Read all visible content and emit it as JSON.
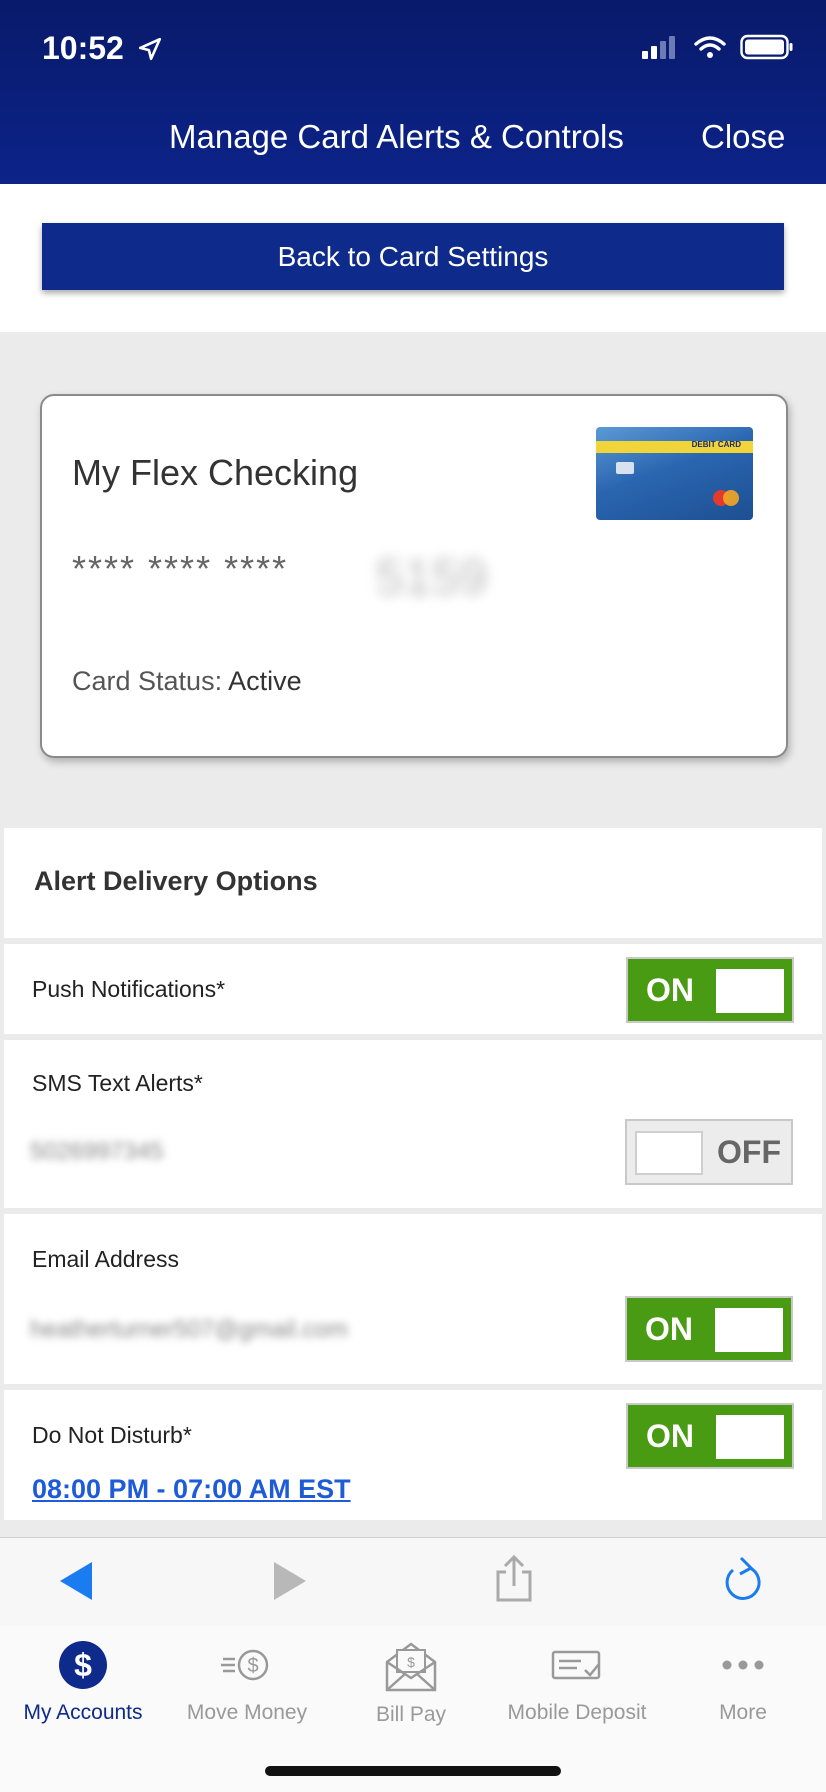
{
  "status_bar": {
    "time": "10:52"
  },
  "nav": {
    "title": "Manage Card Alerts & Controls",
    "close_label": "Close"
  },
  "back_button": {
    "label": "Back to Card Settings"
  },
  "card": {
    "name": "My Flex Checking",
    "masked_number": "**** **** ****",
    "last4": "5159",
    "status_label": "Card Status:",
    "status_value": "Active",
    "thumb_text": "DEBIT CARD"
  },
  "alerts": {
    "section_title": "Alert Delivery Options",
    "push": {
      "label": "Push Notifications*",
      "state": "ON"
    },
    "sms": {
      "label": "SMS Text Alerts*",
      "value": "5026997345",
      "state": "OFF"
    },
    "email": {
      "label": "Email Address",
      "value": "heatherturner507@gmail.com",
      "state": "ON"
    },
    "dnd": {
      "label": "Do Not Disturb*",
      "schedule": "08:00 PM - 07:00 AM EST",
      "state": "ON"
    }
  },
  "tabs": [
    {
      "label": "My Accounts",
      "icon": "dollar-circle-icon",
      "active": true
    },
    {
      "label": "Move Money",
      "icon": "move-money-icon",
      "active": false
    },
    {
      "label": "Bill Pay",
      "icon": "envelope-icon",
      "active": false
    },
    {
      "label": "Mobile Deposit",
      "icon": "check-deposit-icon",
      "active": false
    },
    {
      "label": "More",
      "icon": "more-dots-icon",
      "active": false
    }
  ],
  "colors": {
    "header": "#0c2389",
    "toggle_on": "#4a9b14",
    "link": "#1d5bd8"
  }
}
